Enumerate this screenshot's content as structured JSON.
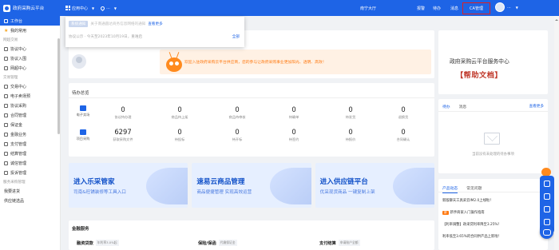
{
  "header": {
    "title": "政府采购云平台",
    "app_center": "应用中心",
    "location": "...",
    "nav": [
      "南宁大厅",
      "报警",
      "待办",
      "消息"
    ],
    "ca_label": "CA管理",
    "user_name": "..."
  },
  "sidebar": {
    "items_top": [
      "工作台",
      "我的常用"
    ],
    "sections": [
      {
        "title": "网超交易",
        "items": [
          "协议中心",
          "协议入围",
          "网超中心"
        ]
      },
      {
        "title": "交易管理",
        "items": [
          "交易中心",
          "电子卖场预",
          "协议采购",
          "合同管理",
          "保证金",
          "金融业务",
          "支付管理",
          "结算管理",
          "诚信管理",
          "投诉管理"
        ]
      },
      {
        "title": "服务采购管理",
        "items": [
          "我要进货",
          "供应链选品"
        ]
      }
    ]
  },
  "notice": {
    "badge": "系统通知",
    "text": "关于南通圆达商务信息网络的通知",
    "link": "查看更多",
    "sub": "协议公示 · 今天至2023年10月19日，重难启",
    "all": "全部"
  },
  "welcome": {
    "text": "欢迎入驻政府采购云平台供应商，您的参与让政府采购事业更加阳光、透明、高效！"
  },
  "todo": {
    "title": "待办总览",
    "rows": [
      {
        "label": "电子卖场",
        "items": [
          {
            "value": "0",
            "label": "协议待办理"
          },
          {
            "value": "0",
            "label": "商品待上架"
          },
          {
            "value": "0",
            "label": "商品待审核"
          },
          {
            "value": "0",
            "label": "待确单"
          },
          {
            "value": "0",
            "label": "待发货"
          },
          {
            "value": "0",
            "label": "退换货"
          }
        ]
      },
      {
        "label": "项目采购",
        "items": [
          {
            "value": "6297",
            "label": "获取采购文件"
          },
          {
            "value": "0",
            "label": "待投标"
          },
          {
            "value": "0",
            "label": "待开标"
          },
          {
            "value": "0",
            "label": "待签约"
          },
          {
            "value": "0",
            "label": "待报价"
          },
          {
            "value": "0",
            "label": "合同确认"
          }
        ]
      }
    ]
  },
  "banners": [
    {
      "title": "进入乐采管家",
      "subtitle": "司南&旺铺装修等工具入口"
    },
    {
      "title": "速易云商品管理",
      "subtitle": "商品便捷管理 实现高效运营"
    },
    {
      "title": "进入供应链平台",
      "subtitle": "优采现货商品 一键复制上架"
    }
  ],
  "finance": {
    "title": "金融服务",
    "items": [
      {
        "name": "融资贷款",
        "tag": "年利率3.0%起"
      },
      {
        "name": "保险/保函",
        "tag": "代缴保证金"
      },
      {
        "name": "支付结算",
        "tag": "申请账户全额"
      }
    ]
  },
  "help": {
    "title": "政府采购云平台服务中心",
    "subtitle": "【帮助文档】"
  },
  "messages": {
    "tabs": [
      "待办",
      "消息"
    ],
    "more": "查看更多",
    "empty": "当前没有未处理的待办事项"
  },
  "news": {
    "tabs": [
      "产品动态",
      "常见问题"
    ],
    "items": [
      {
        "tag": "",
        "text": "新版聊天工具采云IM2.0上线啦！"
      },
      {
        "tag": "新",
        "text": "新手商家入门操作指南"
      },
      {
        "tag": "",
        "text": "【利率调整】政采贷利率降至3.25%！"
      },
      {
        "tag": "",
        "text": "利率低至3.65%的合同供产品上新啦！"
      }
    ]
  },
  "colors": {
    "primary": "#1e64e6",
    "accent": "#ff7a12",
    "alert": "#e02020"
  }
}
